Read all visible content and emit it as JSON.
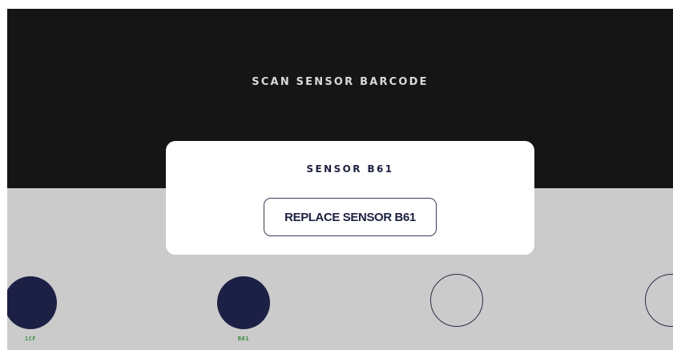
{
  "header": {
    "title": "SCAN SENSOR BARCODE"
  },
  "modal": {
    "title": "SENSOR B61",
    "button_label": "REPLACE SENSOR B61"
  },
  "sensors": [
    {
      "label": "1CF",
      "state": "filled"
    },
    {
      "label": "B61",
      "state": "filled"
    },
    {
      "label": "",
      "state": "empty"
    },
    {
      "label": "",
      "state": "empty"
    }
  ],
  "colors": {
    "header_bg": "#151515",
    "panel_bg": "#cbcbcb",
    "sensor_fill": "#1c2045",
    "sensor_label": "#3a8a3a"
  }
}
